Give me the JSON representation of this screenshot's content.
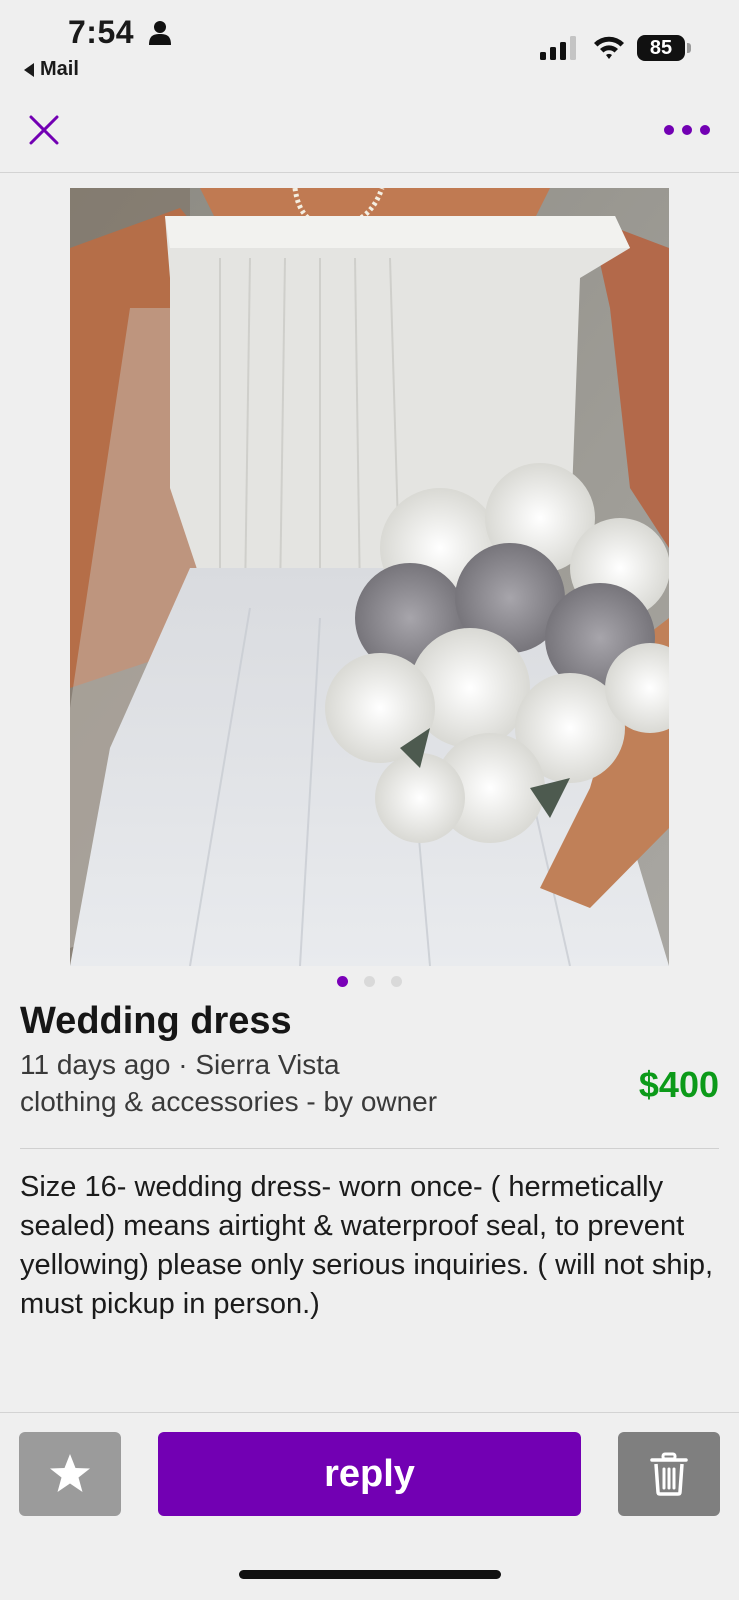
{
  "status_bar": {
    "time": "7:54",
    "back_app": "Mail",
    "battery": "85"
  },
  "nav": {
    "close_icon": "close-x",
    "more_icon": "ellipsis"
  },
  "listing": {
    "image_alt": "wedding dress with white and grey rose bouquet",
    "carousel": {
      "total": 3,
      "active": 1
    },
    "title": "Wedding dress",
    "meta_line1": "11 days ago · Sierra Vista",
    "meta_line2": "clothing & accessories - by owner",
    "price": "$400",
    "description": "Size 16- wedding dress- worn once- ( hermetically sealed) means airtight & waterproof seal, to prevent yellowing) please only serious inquiries. ( will not ship, must pickup in person.)"
  },
  "actions": {
    "favorite_icon": "star",
    "reply_label": "reply",
    "delete_icon": "trash"
  },
  "colors": {
    "accent": "#7200b3",
    "price": "#0c9a19",
    "background": "#efefef"
  }
}
